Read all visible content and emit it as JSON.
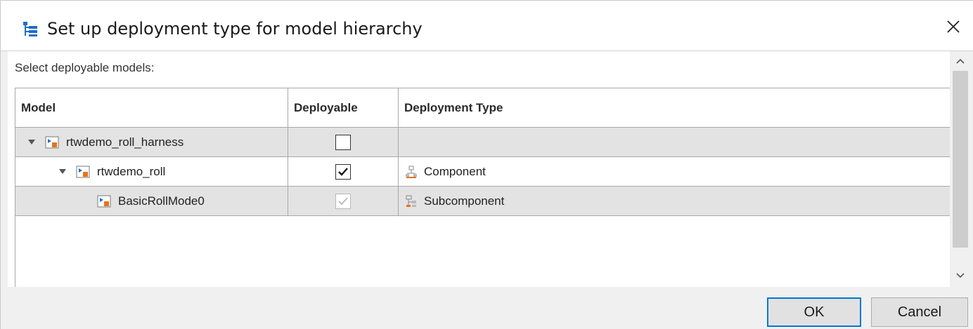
{
  "window": {
    "title": "Set up deployment type for model hierarchy",
    "title_icon": "model-hierarchy-icon",
    "close_icon": "close-icon"
  },
  "content": {
    "prompt": "Select deployable models:"
  },
  "table": {
    "columns": [
      "Model",
      "Deployable",
      "Deployment Type"
    ],
    "rows": [
      {
        "model": "rtwdemo_roll_harness",
        "level": 0,
        "expanded": true,
        "deployable": false,
        "deployable_enabled": true,
        "deployment_type": "",
        "deployment_type_icon": ""
      },
      {
        "model": "rtwdemo_roll",
        "level": 1,
        "expanded": true,
        "deployable": true,
        "deployable_enabled": true,
        "deployment_type": "Component",
        "deployment_type_icon": "component-icon"
      },
      {
        "model": "BasicRollMode0",
        "level": 2,
        "expanded": null,
        "deployable": true,
        "deployable_enabled": false,
        "deployment_type": "Subcomponent",
        "deployment_type_icon": "subcomponent-icon"
      }
    ]
  },
  "buttons": {
    "ok": "OK",
    "cancel": "Cancel"
  },
  "colors": {
    "accent": "#0078d7",
    "row_shaded": "#e3e3e3",
    "model_icon_blue": "#1f6fc5",
    "model_icon_orange": "#e8731b"
  }
}
